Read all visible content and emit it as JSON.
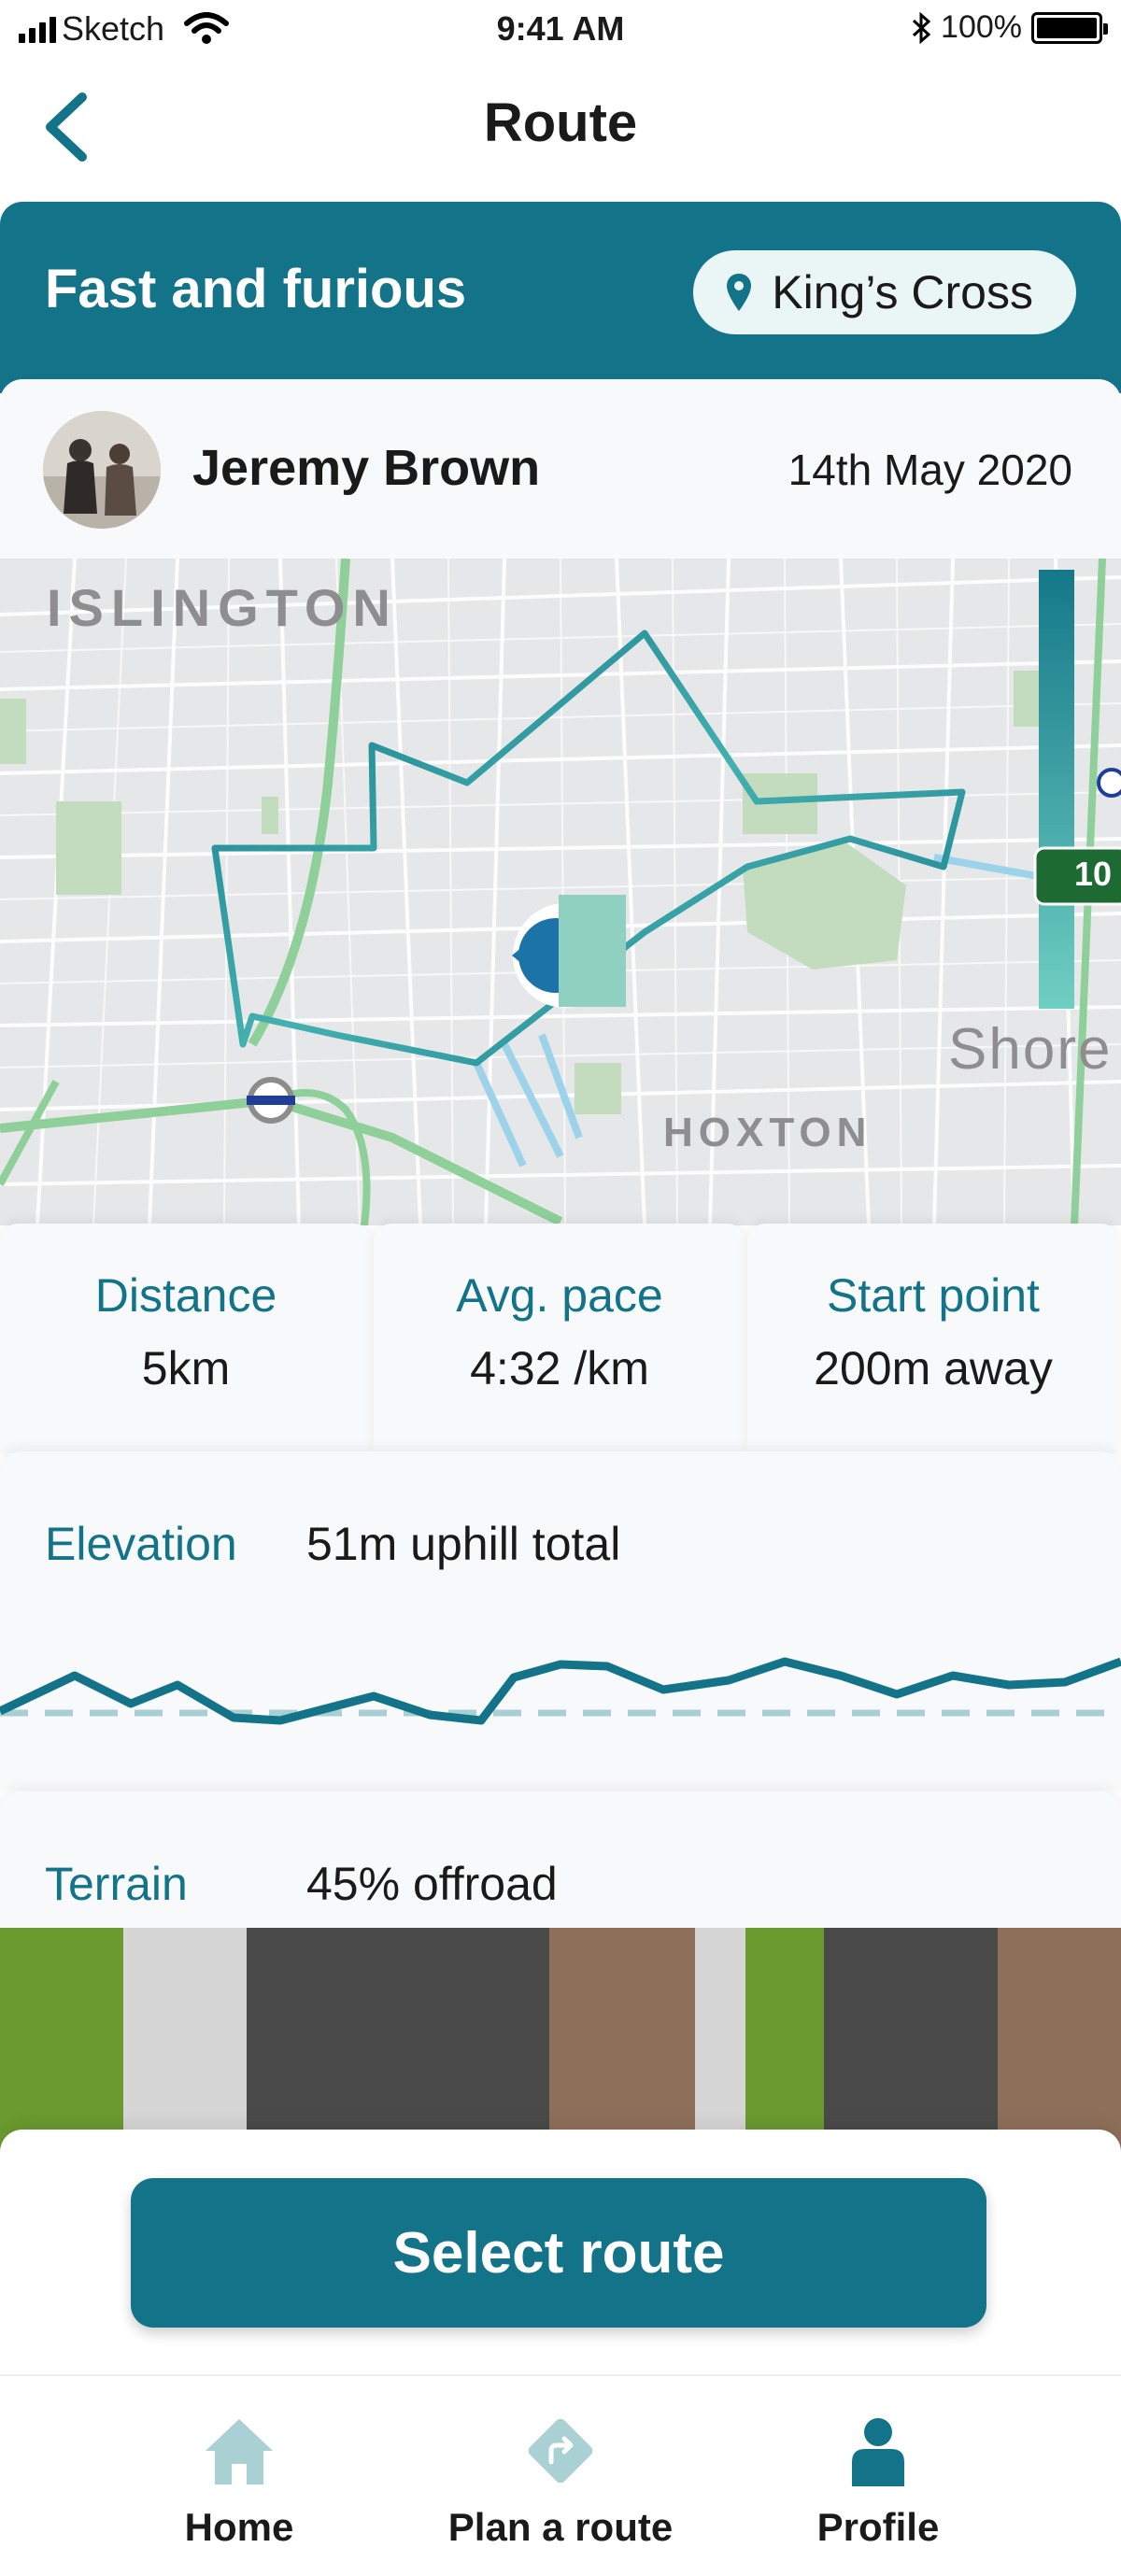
{
  "status_bar": {
    "carrier": "Sketch",
    "time": "9:41 AM",
    "battery": "100%"
  },
  "nav": {
    "title": "Route"
  },
  "route": {
    "name": "Fast and furious",
    "location": "King’s Cross"
  },
  "author": {
    "name": "Jeremy Brown",
    "date": "14th May 2020"
  },
  "map": {
    "labels": {
      "islington": "ISLINGTON",
      "hoxton": "HOXTON",
      "shoreditch": "Shore",
      "road_marker": "10"
    }
  },
  "stats": [
    {
      "label": "Distance",
      "value": "5km"
    },
    {
      "label": "Avg. pace",
      "value": "4:32 /km"
    },
    {
      "label": "Start point",
      "value": "200m away"
    }
  ],
  "elevation": {
    "label": "Elevation",
    "value": "51m uphill total"
  },
  "terrain": {
    "label": "Terrain",
    "value": "45% offroad",
    "segments": [
      {
        "type": "grass",
        "color": "#6b9a30",
        "share": 0.11
      },
      {
        "type": "path",
        "color": "#d6d6d6",
        "share": 0.11
      },
      {
        "type": "road",
        "color": "#4a4a4a",
        "share": 0.27
      },
      {
        "type": "trail",
        "color": "#8e6f5a",
        "share": 0.13
      },
      {
        "type": "path",
        "color": "#d6d6d6",
        "share": 0.045
      },
      {
        "type": "grass",
        "color": "#6b9a30",
        "share": 0.07
      },
      {
        "type": "road",
        "color": "#4a4a4a",
        "share": 0.155
      },
      {
        "type": "trail",
        "color": "#8e6f5a",
        "share": 0.11
      }
    ]
  },
  "action": {
    "select_label": "Select route"
  },
  "tabs": [
    {
      "label": "Home",
      "icon": "home-icon"
    },
    {
      "label": "Plan a route",
      "icon": "directions-icon"
    },
    {
      "label": "Profile",
      "icon": "profile-icon"
    }
  ],
  "colors": {
    "primary": "#137388",
    "accent": "#5bbcb1",
    "tab_inactive": "#a9d0d2"
  }
}
